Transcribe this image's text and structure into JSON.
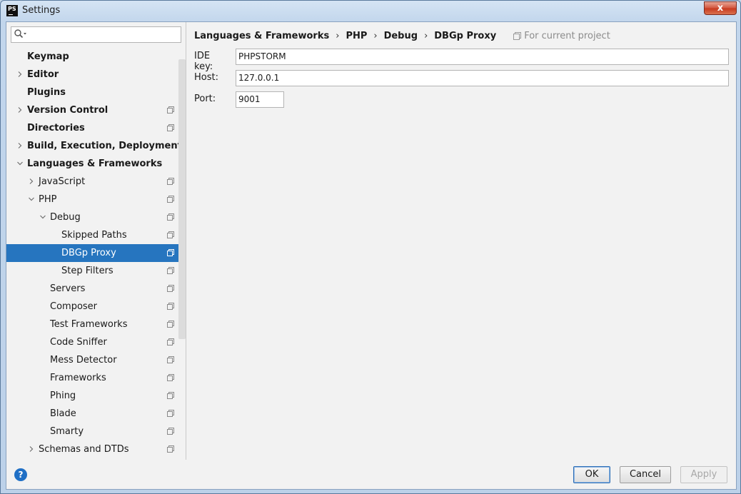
{
  "window": {
    "title": "Settings",
    "app_icon_text": "PS",
    "close_label": "x"
  },
  "search": {
    "placeholder": "",
    "value": ""
  },
  "tree": [
    {
      "label": "Keymap",
      "level": 0,
      "bold": true,
      "arrow": "none",
      "project": false
    },
    {
      "label": "Editor",
      "level": 0,
      "bold": true,
      "arrow": "right",
      "project": false
    },
    {
      "label": "Plugins",
      "level": 0,
      "bold": true,
      "arrow": "none",
      "project": false
    },
    {
      "label": "Version Control",
      "level": 0,
      "bold": true,
      "arrow": "right",
      "project": true
    },
    {
      "label": "Directories",
      "level": 0,
      "bold": true,
      "arrow": "none",
      "project": true
    },
    {
      "label": "Build, Execution, Deployment",
      "level": 0,
      "bold": true,
      "arrow": "right",
      "project": false
    },
    {
      "label": "Languages & Frameworks",
      "level": 0,
      "bold": true,
      "arrow": "down",
      "project": false
    },
    {
      "label": "JavaScript",
      "level": 1,
      "bold": false,
      "arrow": "right",
      "project": true
    },
    {
      "label": "PHP",
      "level": 1,
      "bold": false,
      "arrow": "down",
      "project": true
    },
    {
      "label": "Debug",
      "level": 2,
      "bold": false,
      "arrow": "down",
      "project": true
    },
    {
      "label": "Skipped Paths",
      "level": 3,
      "bold": false,
      "arrow": "none",
      "project": true
    },
    {
      "label": "DBGp Proxy",
      "level": 3,
      "bold": false,
      "arrow": "none",
      "project": true,
      "selected": true
    },
    {
      "label": "Step Filters",
      "level": 3,
      "bold": false,
      "arrow": "none",
      "project": true
    },
    {
      "label": "Servers",
      "level": 2,
      "bold": false,
      "arrow": "none",
      "project": true
    },
    {
      "label": "Composer",
      "level": 2,
      "bold": false,
      "arrow": "none",
      "project": true
    },
    {
      "label": "Test Frameworks",
      "level": 2,
      "bold": false,
      "arrow": "none",
      "project": true
    },
    {
      "label": "Code Sniffer",
      "level": 2,
      "bold": false,
      "arrow": "none",
      "project": true
    },
    {
      "label": "Mess Detector",
      "level": 2,
      "bold": false,
      "arrow": "none",
      "project": true
    },
    {
      "label": "Frameworks",
      "level": 2,
      "bold": false,
      "arrow": "none",
      "project": true
    },
    {
      "label": "Phing",
      "level": 2,
      "bold": false,
      "arrow": "none",
      "project": true
    },
    {
      "label": "Blade",
      "level": 2,
      "bold": false,
      "arrow": "none",
      "project": true
    },
    {
      "label": "Smarty",
      "level": 2,
      "bold": false,
      "arrow": "none",
      "project": true
    },
    {
      "label": "Schemas and DTDs",
      "level": 1,
      "bold": false,
      "arrow": "right",
      "project": true
    }
  ],
  "breadcrumb": {
    "items": [
      "Languages & Frameworks",
      "PHP",
      "Debug",
      "DBGp Proxy"
    ],
    "separator": "›",
    "scope": "For current project"
  },
  "form": {
    "ide_key": {
      "label": "IDE key:",
      "value": "PHPSTORM"
    },
    "host": {
      "label": "Host:",
      "value": "127.0.0.1"
    },
    "port": {
      "label": "Port:",
      "value": "9001"
    }
  },
  "buttons": {
    "help": "?",
    "ok": "OK",
    "cancel": "Cancel",
    "apply": "Apply"
  },
  "colors": {
    "selection": "#2675bf",
    "help": "#1f6fc5",
    "close": "#c7381e"
  }
}
